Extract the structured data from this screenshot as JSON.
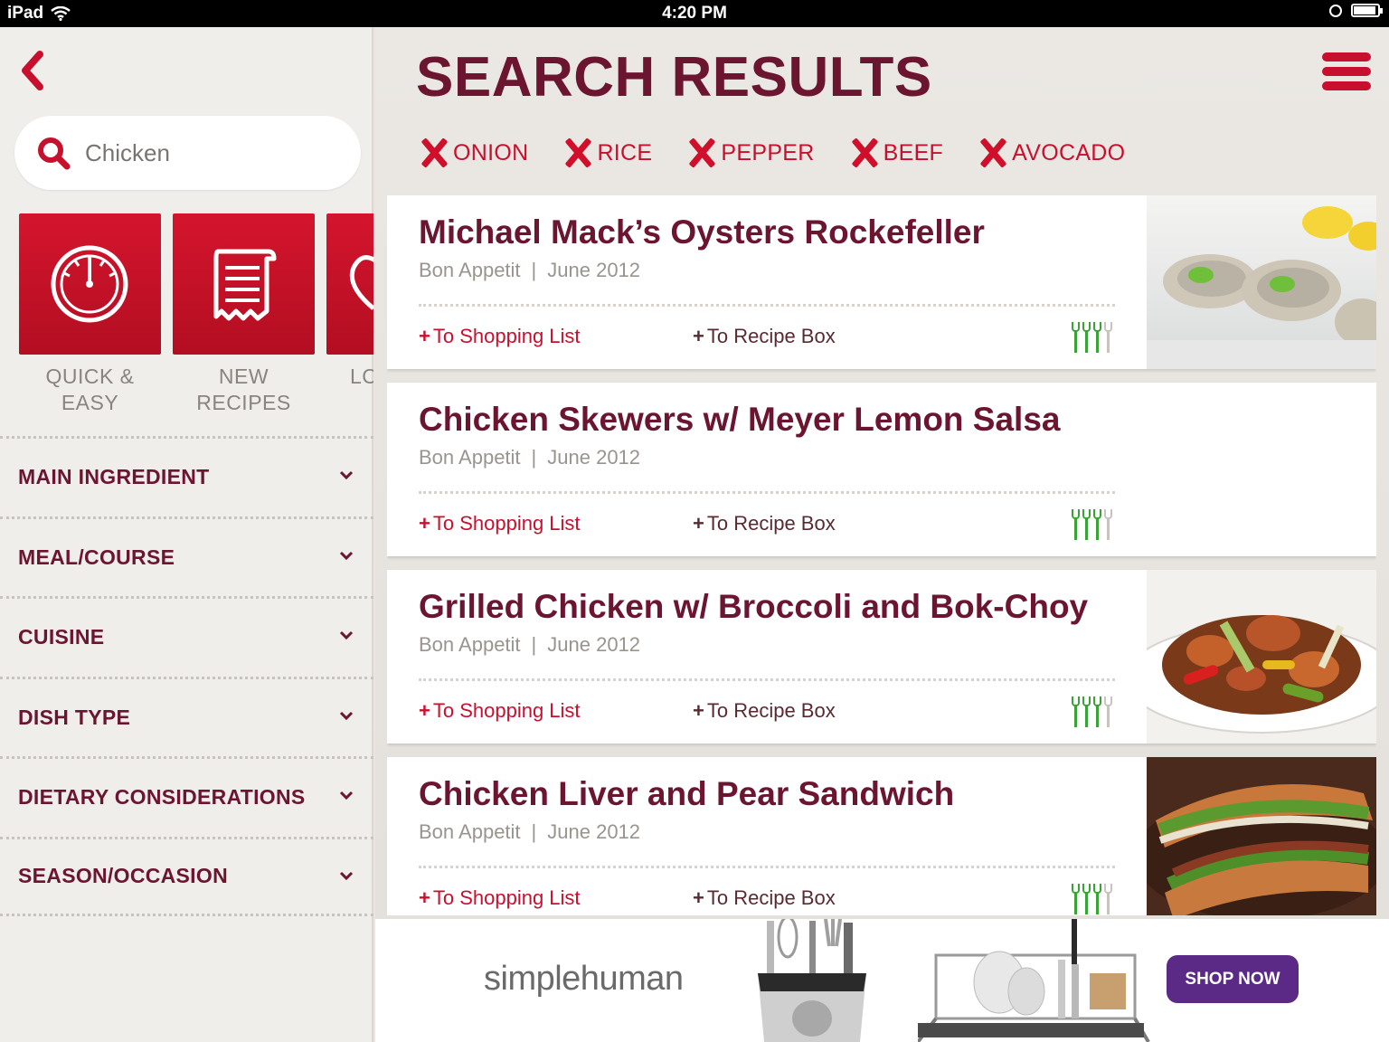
{
  "status_bar": {
    "device": "iPad",
    "time": "4:20 PM",
    "battery_level": 0.92,
    "icons": [
      "wifi-icon",
      "clock-icon",
      "battery-icon"
    ]
  },
  "sidebar": {
    "search": {
      "value": "Chicken",
      "placeholder": "Chicken"
    },
    "tiles": [
      {
        "label_line1": "QUICK &",
        "label_line2": "EASY",
        "icon": "stopwatch-icon"
      },
      {
        "label_line1": "NEW",
        "label_line2": "RECIPES",
        "icon": "scroll-recipe-icon"
      },
      {
        "label_line1": "LC",
        "label_line2": "",
        "icon": "heart-icon"
      }
    ],
    "filters": [
      {
        "label": "MAIN INGREDIENT"
      },
      {
        "label": "MEAL/COURSE"
      },
      {
        "label": "CUISINE"
      },
      {
        "label": "DISH TYPE"
      },
      {
        "label": "DIETARY CONSIDERATIONS"
      },
      {
        "label": "SEASON/OCCASION"
      }
    ]
  },
  "main": {
    "title": "SEARCH RESULTS",
    "excluded_ingredients": [
      "ONION",
      "RICE",
      "PEPPER",
      "BEEF",
      "AVOCADO"
    ],
    "results": [
      {
        "title": "Michael Mack’s Oysters Rockefeller",
        "source": "Bon Appetit",
        "date": "June 2012",
        "shopping_label": "To Shopping List",
        "recipe_box_label": "To Recipe Box",
        "rating": 3,
        "rating_max": 4,
        "photo": "oysters"
      },
      {
        "title": "Chicken Skewers w/ Meyer Lemon Salsa",
        "source": "Bon Appetit",
        "date": "June 2012",
        "shopping_label": "To Shopping List",
        "recipe_box_label": "To Recipe Box",
        "rating": 3,
        "rating_max": 4,
        "photo": ""
      },
      {
        "title": "Grilled Chicken w/ Broccoli and Bok-Choy",
        "source": "Bon Appetit",
        "date": "June 2012",
        "shopping_label": "To Shopping List",
        "recipe_box_label": "To Recipe Box",
        "rating": 3,
        "rating_max": 4,
        "photo": "stirfry"
      },
      {
        "title": "Chicken Liver and Pear Sandwich",
        "source": "Bon Appetit",
        "date": "June 2012",
        "shopping_label": "To Shopping List",
        "recipe_box_label": "To Recipe Box",
        "rating": 3,
        "rating_max": 4,
        "photo": "sandwich"
      }
    ]
  },
  "ad": {
    "brand": "simplehuman",
    "cta": "SHOP NOW",
    "colors": {
      "cta_bg": "#5b2a86"
    }
  },
  "colors": {
    "accent_red": "#c8102e",
    "title_maroon": "#6b1530",
    "rating_green": "#3aa335"
  }
}
